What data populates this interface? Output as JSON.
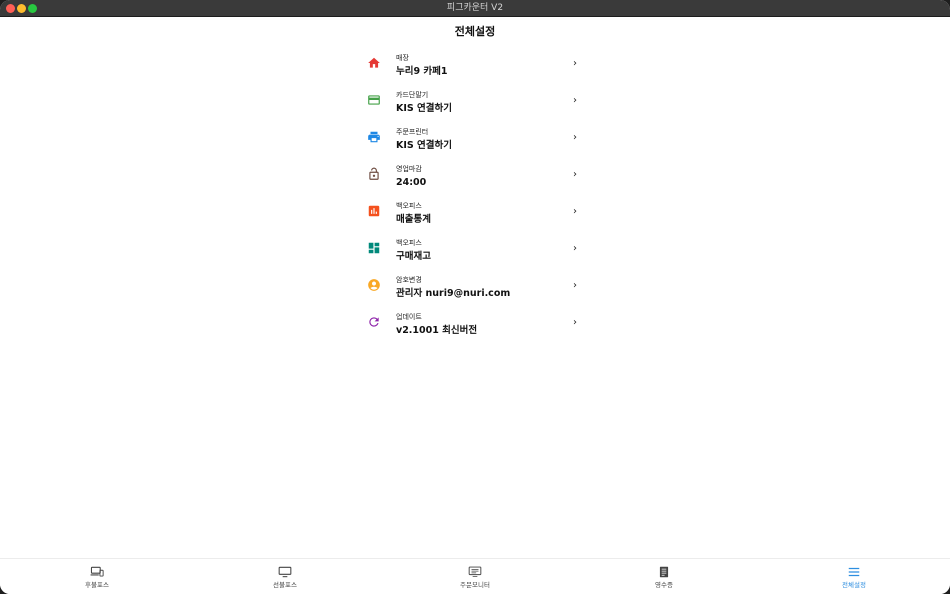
{
  "window": {
    "title": "피그카운터 V2"
  },
  "page": {
    "title": "전체설정"
  },
  "settings": [
    {
      "label": "매장",
      "value": "누리9 카페1",
      "icon": "home-icon",
      "color": "#e53935"
    },
    {
      "label": "카드단말기",
      "value": "KIS 연결하기",
      "icon": "credit-card-icon",
      "color": "#43a047"
    },
    {
      "label": "주문프린터",
      "value": "KIS 연결하기",
      "icon": "printer-icon",
      "color": "#1e88e5"
    },
    {
      "label": "영업마감",
      "value": "24:00",
      "icon": "lock-open-icon",
      "color": "#6d4c41"
    },
    {
      "label": "백오피스",
      "value": "매출통계",
      "icon": "bar-chart-icon",
      "color": "#f4511e"
    },
    {
      "label": "백오피스",
      "value": "구매재고",
      "icon": "dashboard-icon",
      "color": "#00897b"
    },
    {
      "label": "암호변경",
      "value": "관리자 nuri9@nuri.com",
      "icon": "account-circle-icon",
      "color": "#f9a825"
    },
    {
      "label": "업데이트",
      "value": "v2.1001 최신버전",
      "icon": "refresh-icon",
      "color": "#8e24aa"
    }
  ],
  "nav": {
    "items": [
      {
        "label": "후불포스",
        "icon": "devices-icon"
      },
      {
        "label": "선불포스",
        "icon": "monitor-icon"
      },
      {
        "label": "주문모니터",
        "icon": "order-monitor-icon"
      },
      {
        "label": "영수증",
        "icon": "receipt-icon"
      },
      {
        "label": "전체설정",
        "icon": "menu-icon"
      }
    ],
    "active_index": 4,
    "active_color": "#2d8ee0",
    "inactive_color": "#444444"
  }
}
